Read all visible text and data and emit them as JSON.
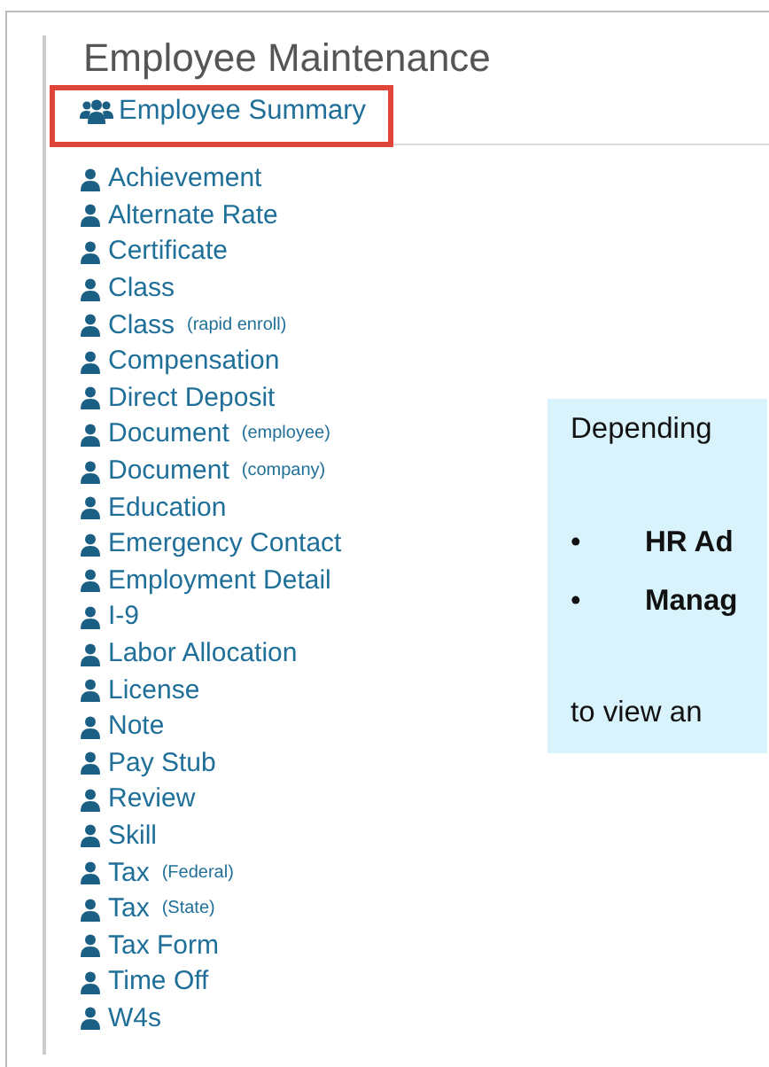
{
  "title": "Employee Maintenance",
  "summary_link": {
    "label": "Employee Summary",
    "highlighted": true
  },
  "menu_items": [
    {
      "label": "Achievement"
    },
    {
      "label": "Alternate Rate"
    },
    {
      "label": "Certificate"
    },
    {
      "label": "Class"
    },
    {
      "label": "Class",
      "note": "(rapid enroll)"
    },
    {
      "label": "Compensation"
    },
    {
      "label": "Direct Deposit"
    },
    {
      "label": "Document",
      "note": "(employee)"
    },
    {
      "label": "Document",
      "note": "(company)"
    },
    {
      "label": "Education"
    },
    {
      "label": "Emergency Contact"
    },
    {
      "label": "Employment Detail"
    },
    {
      "label": "I-9"
    },
    {
      "label": "Labor Allocation"
    },
    {
      "label": "License"
    },
    {
      "label": "Note"
    },
    {
      "label": "Pay Stub"
    },
    {
      "label": "Review"
    },
    {
      "label": "Skill"
    },
    {
      "label": "Tax",
      "note": "(Federal)"
    },
    {
      "label": "Tax",
      "note": "(State)"
    },
    {
      "label": "Tax Form"
    },
    {
      "label": "Time Off"
    },
    {
      "label": "W4s"
    }
  ],
  "callout": {
    "intro": "Depending",
    "bullets": [
      {
        "marker": "•",
        "text": "HR Ad"
      },
      {
        "marker": "•",
        "text": "Manag"
      }
    ],
    "outro": "to view an"
  }
}
